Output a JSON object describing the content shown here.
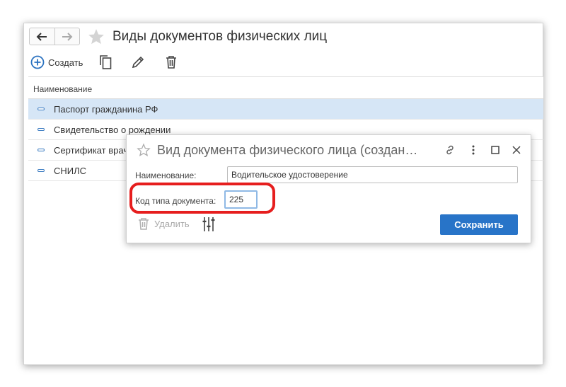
{
  "window": {
    "title": "Виды документов физических лиц"
  },
  "toolbar": {
    "create_label": "Создать"
  },
  "list": {
    "column_header": "Наименование",
    "rows": [
      {
        "label": "Паспорт гражданина РФ"
      },
      {
        "label": "Свидетельство о рождении"
      },
      {
        "label": "Сертификат врача"
      },
      {
        "label": "СНИЛС"
      }
    ]
  },
  "dialog": {
    "title": "Вид документа физического лица (создан…",
    "name_label": "Наименование:",
    "name_value": "Водительское удостоверение",
    "code_label": "Код типа документа:",
    "code_value": "225",
    "delete_label": "Удалить",
    "save_label": "Сохранить"
  },
  "colors": {
    "accent": "#2874c8",
    "selected_row": "#d6e6f6",
    "highlight": "#e61e1e"
  }
}
